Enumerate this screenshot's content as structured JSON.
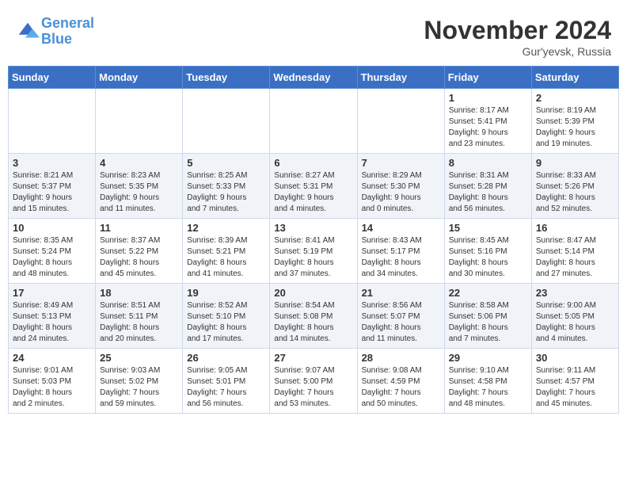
{
  "header": {
    "logo_line1": "General",
    "logo_line2": "Blue",
    "month_title": "November 2024",
    "location": "Gur'yevsk, Russia"
  },
  "weekdays": [
    "Sunday",
    "Monday",
    "Tuesday",
    "Wednesday",
    "Thursday",
    "Friday",
    "Saturday"
  ],
  "weeks": [
    [
      {
        "day": "",
        "info": ""
      },
      {
        "day": "",
        "info": ""
      },
      {
        "day": "",
        "info": ""
      },
      {
        "day": "",
        "info": ""
      },
      {
        "day": "",
        "info": ""
      },
      {
        "day": "1",
        "info": "Sunrise: 8:17 AM\nSunset: 5:41 PM\nDaylight: 9 hours\nand 23 minutes."
      },
      {
        "day": "2",
        "info": "Sunrise: 8:19 AM\nSunset: 5:39 PM\nDaylight: 9 hours\nand 19 minutes."
      }
    ],
    [
      {
        "day": "3",
        "info": "Sunrise: 8:21 AM\nSunset: 5:37 PM\nDaylight: 9 hours\nand 15 minutes."
      },
      {
        "day": "4",
        "info": "Sunrise: 8:23 AM\nSunset: 5:35 PM\nDaylight: 9 hours\nand 11 minutes."
      },
      {
        "day": "5",
        "info": "Sunrise: 8:25 AM\nSunset: 5:33 PM\nDaylight: 9 hours\nand 7 minutes."
      },
      {
        "day": "6",
        "info": "Sunrise: 8:27 AM\nSunset: 5:31 PM\nDaylight: 9 hours\nand 4 minutes."
      },
      {
        "day": "7",
        "info": "Sunrise: 8:29 AM\nSunset: 5:30 PM\nDaylight: 9 hours\nand 0 minutes."
      },
      {
        "day": "8",
        "info": "Sunrise: 8:31 AM\nSunset: 5:28 PM\nDaylight: 8 hours\nand 56 minutes."
      },
      {
        "day": "9",
        "info": "Sunrise: 8:33 AM\nSunset: 5:26 PM\nDaylight: 8 hours\nand 52 minutes."
      }
    ],
    [
      {
        "day": "10",
        "info": "Sunrise: 8:35 AM\nSunset: 5:24 PM\nDaylight: 8 hours\nand 48 minutes."
      },
      {
        "day": "11",
        "info": "Sunrise: 8:37 AM\nSunset: 5:22 PM\nDaylight: 8 hours\nand 45 minutes."
      },
      {
        "day": "12",
        "info": "Sunrise: 8:39 AM\nSunset: 5:21 PM\nDaylight: 8 hours\nand 41 minutes."
      },
      {
        "day": "13",
        "info": "Sunrise: 8:41 AM\nSunset: 5:19 PM\nDaylight: 8 hours\nand 37 minutes."
      },
      {
        "day": "14",
        "info": "Sunrise: 8:43 AM\nSunset: 5:17 PM\nDaylight: 8 hours\nand 34 minutes."
      },
      {
        "day": "15",
        "info": "Sunrise: 8:45 AM\nSunset: 5:16 PM\nDaylight: 8 hours\nand 30 minutes."
      },
      {
        "day": "16",
        "info": "Sunrise: 8:47 AM\nSunset: 5:14 PM\nDaylight: 8 hours\nand 27 minutes."
      }
    ],
    [
      {
        "day": "17",
        "info": "Sunrise: 8:49 AM\nSunset: 5:13 PM\nDaylight: 8 hours\nand 24 minutes."
      },
      {
        "day": "18",
        "info": "Sunrise: 8:51 AM\nSunset: 5:11 PM\nDaylight: 8 hours\nand 20 minutes."
      },
      {
        "day": "19",
        "info": "Sunrise: 8:52 AM\nSunset: 5:10 PM\nDaylight: 8 hours\nand 17 minutes."
      },
      {
        "day": "20",
        "info": "Sunrise: 8:54 AM\nSunset: 5:08 PM\nDaylight: 8 hours\nand 14 minutes."
      },
      {
        "day": "21",
        "info": "Sunrise: 8:56 AM\nSunset: 5:07 PM\nDaylight: 8 hours\nand 11 minutes."
      },
      {
        "day": "22",
        "info": "Sunrise: 8:58 AM\nSunset: 5:06 PM\nDaylight: 8 hours\nand 7 minutes."
      },
      {
        "day": "23",
        "info": "Sunrise: 9:00 AM\nSunset: 5:05 PM\nDaylight: 8 hours\nand 4 minutes."
      }
    ],
    [
      {
        "day": "24",
        "info": "Sunrise: 9:01 AM\nSunset: 5:03 PM\nDaylight: 8 hours\nand 2 minutes."
      },
      {
        "day": "25",
        "info": "Sunrise: 9:03 AM\nSunset: 5:02 PM\nDaylight: 7 hours\nand 59 minutes."
      },
      {
        "day": "26",
        "info": "Sunrise: 9:05 AM\nSunset: 5:01 PM\nDaylight: 7 hours\nand 56 minutes."
      },
      {
        "day": "27",
        "info": "Sunrise: 9:07 AM\nSunset: 5:00 PM\nDaylight: 7 hours\nand 53 minutes."
      },
      {
        "day": "28",
        "info": "Sunrise: 9:08 AM\nSunset: 4:59 PM\nDaylight: 7 hours\nand 50 minutes."
      },
      {
        "day": "29",
        "info": "Sunrise: 9:10 AM\nSunset: 4:58 PM\nDaylight: 7 hours\nand 48 minutes."
      },
      {
        "day": "30",
        "info": "Sunrise: 9:11 AM\nSunset: 4:57 PM\nDaylight: 7 hours\nand 45 minutes."
      }
    ]
  ]
}
